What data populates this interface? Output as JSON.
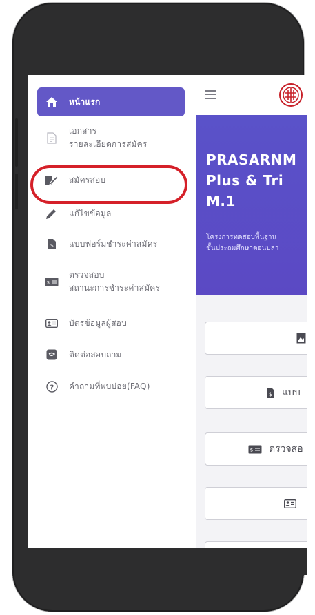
{
  "sidebar": {
    "items": [
      {
        "label": "หน้าแรก",
        "icon": "home-icon",
        "active": true
      },
      {
        "label_1": "เอกสาร",
        "label_2": "รายละเอียดการสมัคร",
        "icon": "document-icon"
      },
      {
        "label": "สมัครสอบ",
        "icon": "edit-form-icon",
        "highlighted": true
      },
      {
        "label": "แก้ไขข้อมูล",
        "icon": "pencil-icon"
      },
      {
        "label": "แบบฟอร์มชำระค่าสมัคร",
        "icon": "invoice-icon"
      },
      {
        "label_1": "ตรวจสอบ",
        "label_2": "สถานะการชำระค่าสมัคร",
        "icon": "money-icon"
      },
      {
        "label": "บัตรข้อมูลผู้สอบ",
        "icon": "id-card-icon"
      },
      {
        "label": "ติดต่อสอบถาม",
        "icon": "chat-icon"
      },
      {
        "label": "คำถามที่พบบ่อย(FAQ)",
        "icon": "help-circle-icon"
      }
    ]
  },
  "hero": {
    "title": "PRASARNM\nPlus & Tri\nM.1",
    "description": "โครงการทดสอบพื้นฐาน\nชั้นประถมศึกษาตอนปลา"
  },
  "cards": [
    {
      "label": "",
      "icon": "image-doc-icon"
    },
    {
      "label": "แบบ",
      "icon": "invoice-icon"
    },
    {
      "label": "ตรวจสอ",
      "icon": "money-icon"
    },
    {
      "label": "",
      "icon": "id-card-icon"
    }
  ],
  "colors": {
    "accent": "#6358c7",
    "hero_bg": "#5a52c9",
    "highlight": "#d52029",
    "phone_frame": "#2d2d2e"
  }
}
